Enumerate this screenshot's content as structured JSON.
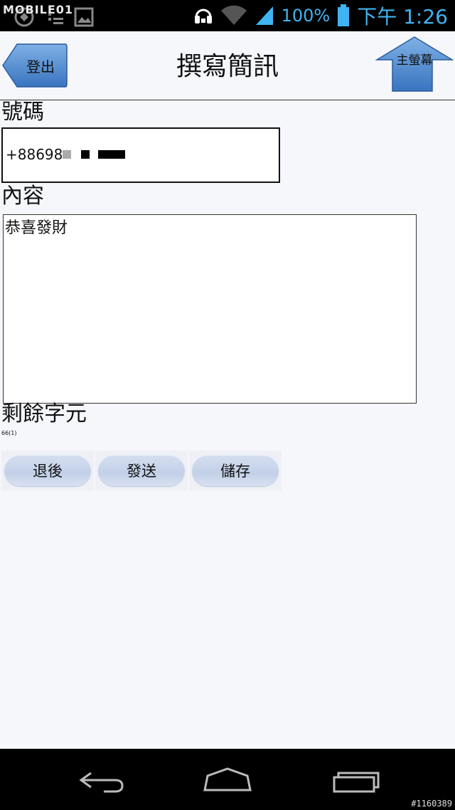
{
  "status_bar": {
    "watermark": "MOBILE01",
    "battery_percent": "100%",
    "time": "下午 1:26",
    "icons": [
      "usb-icon",
      "notification-icon",
      "image-icon",
      "headset-icon",
      "wifi-icon",
      "signal-icon",
      "battery-icon"
    ],
    "accent_color": "#3fb4f0"
  },
  "header": {
    "back_label": "登出",
    "title": "撰寫簡訊",
    "home_label": "主螢幕"
  },
  "form": {
    "number_label": "號碼",
    "number_value": "+88698",
    "content_label": "內容",
    "content_value": "恭喜發財",
    "remaining_label": "剩餘字元",
    "remaining_value": "66(1)"
  },
  "actions": {
    "back_label": "退後",
    "send_label": "發送",
    "save_label": "儲存"
  },
  "nav_bar": {
    "icons": [
      "back-icon",
      "home-icon",
      "recent-apps-icon"
    ]
  },
  "watermark_id": "#1160389"
}
